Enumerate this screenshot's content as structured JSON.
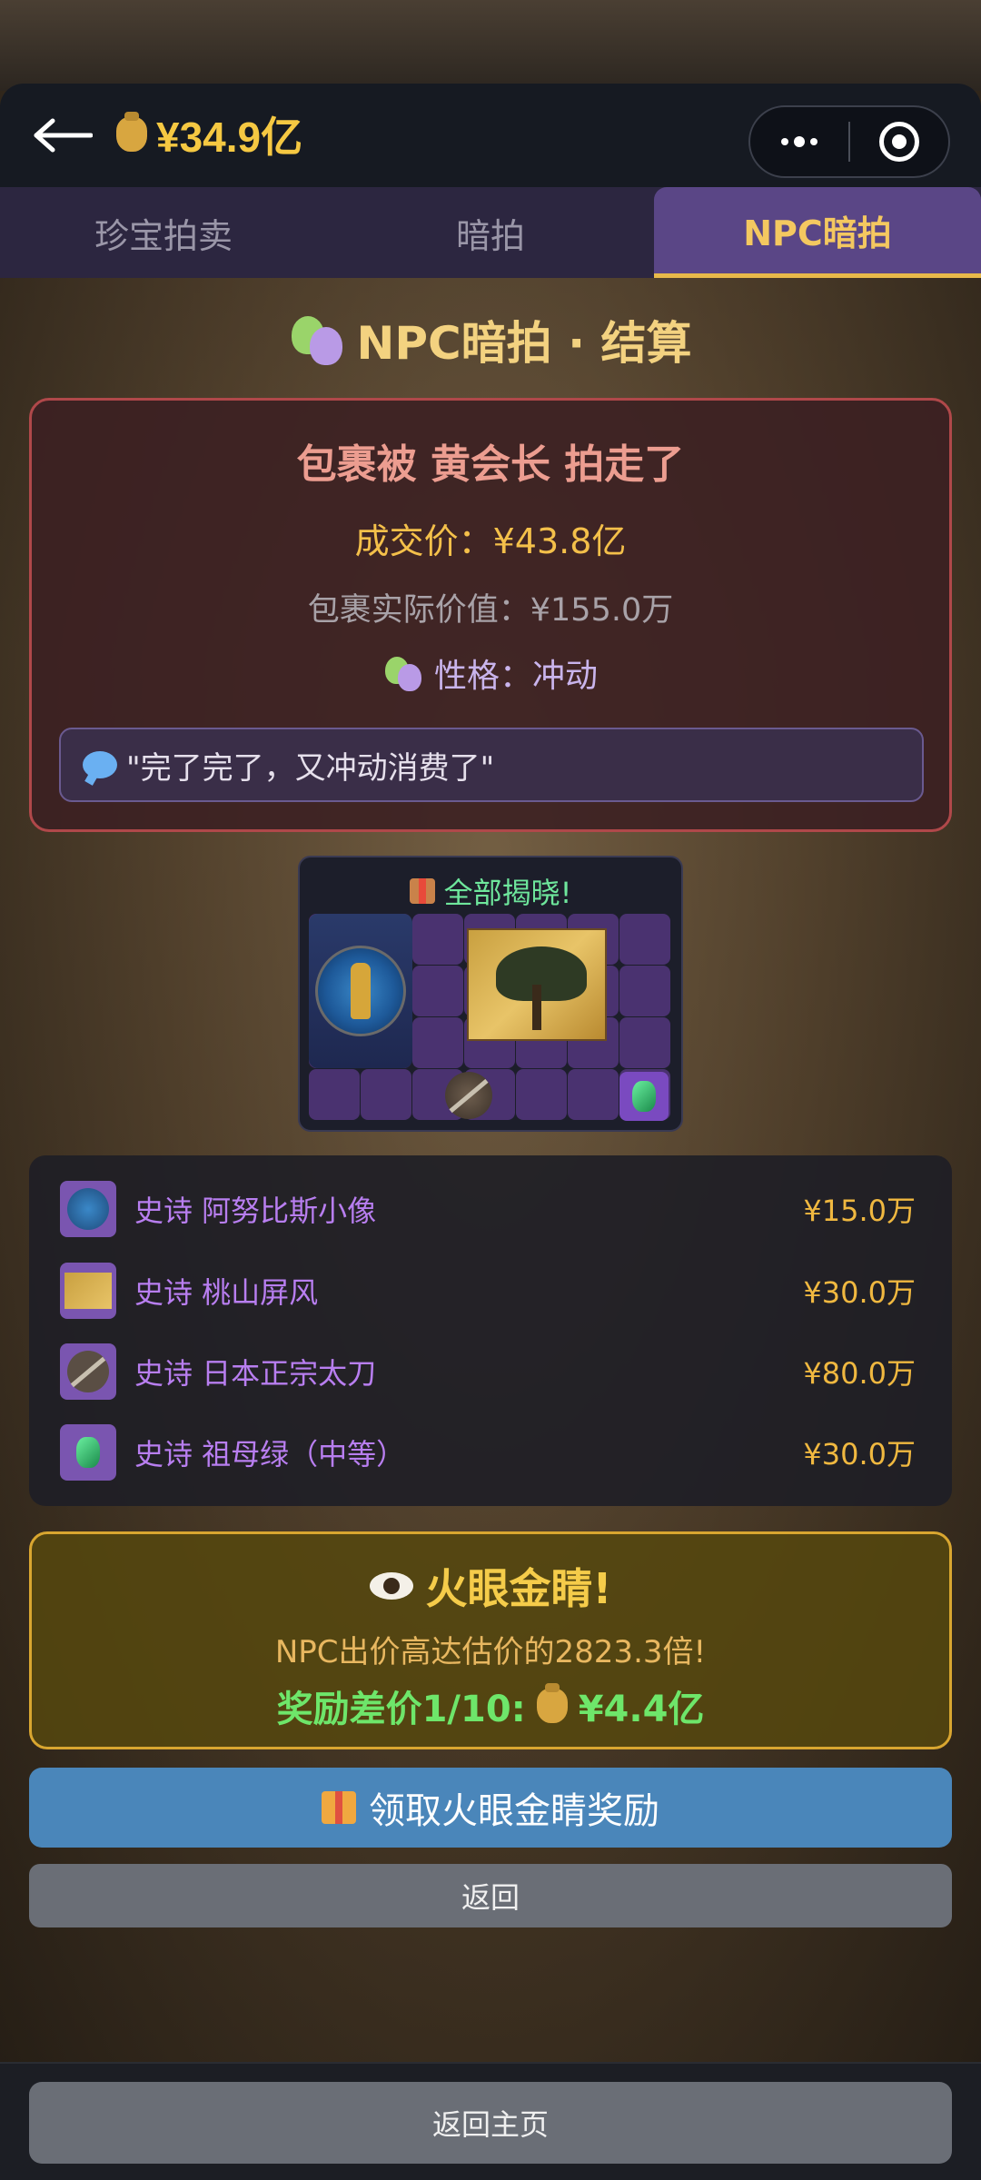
{
  "header": {
    "balance": "¥34.9亿",
    "coin_icon": "money-bag-icon",
    "back_icon": "back-arrow-icon"
  },
  "tabs": [
    {
      "label": "珍宝拍卖",
      "active": false
    },
    {
      "label": "暗拍",
      "active": false
    },
    {
      "label": "NPC暗拍",
      "active": true
    }
  ],
  "page_title": "NPC暗拍 · 结算",
  "result": {
    "headline": "包裹被 黄会长 拍走了",
    "deal_price": "成交价：¥43.8亿",
    "actual_value": "包裹实际价值：¥155.0万",
    "personality": "性格：冲动",
    "quote": "\"完了完了，又冲动消费了\""
  },
  "reveal": {
    "title": "全部揭晓!"
  },
  "items": [
    {
      "name": "史诗 阿努比斯小像",
      "price": "¥15.0万"
    },
    {
      "name": "史诗 桃山屏风",
      "price": "¥30.0万"
    },
    {
      "name": "史诗 日本正宗太刀",
      "price": "¥80.0万"
    },
    {
      "name": "史诗 祖母绿（中等）",
      "price": "¥30.0万"
    }
  ],
  "reward": {
    "title": "火眼金睛!",
    "subtitle": "NPC出价高达估价的2823.3倍!",
    "bonus_label": "奖励差价1/10:",
    "bonus_value": "¥4.4亿"
  },
  "buttons": {
    "claim": "领取火眼金睛奖励",
    "back": "返回",
    "home": "返回主页"
  },
  "colors": {
    "accent_gold": "#f5c842",
    "tab_active_bg": "#5a4686",
    "claim_button": "#4a86ba",
    "reward_text_green": "#6ee66a",
    "item_name_purple": "#b87ef0"
  }
}
